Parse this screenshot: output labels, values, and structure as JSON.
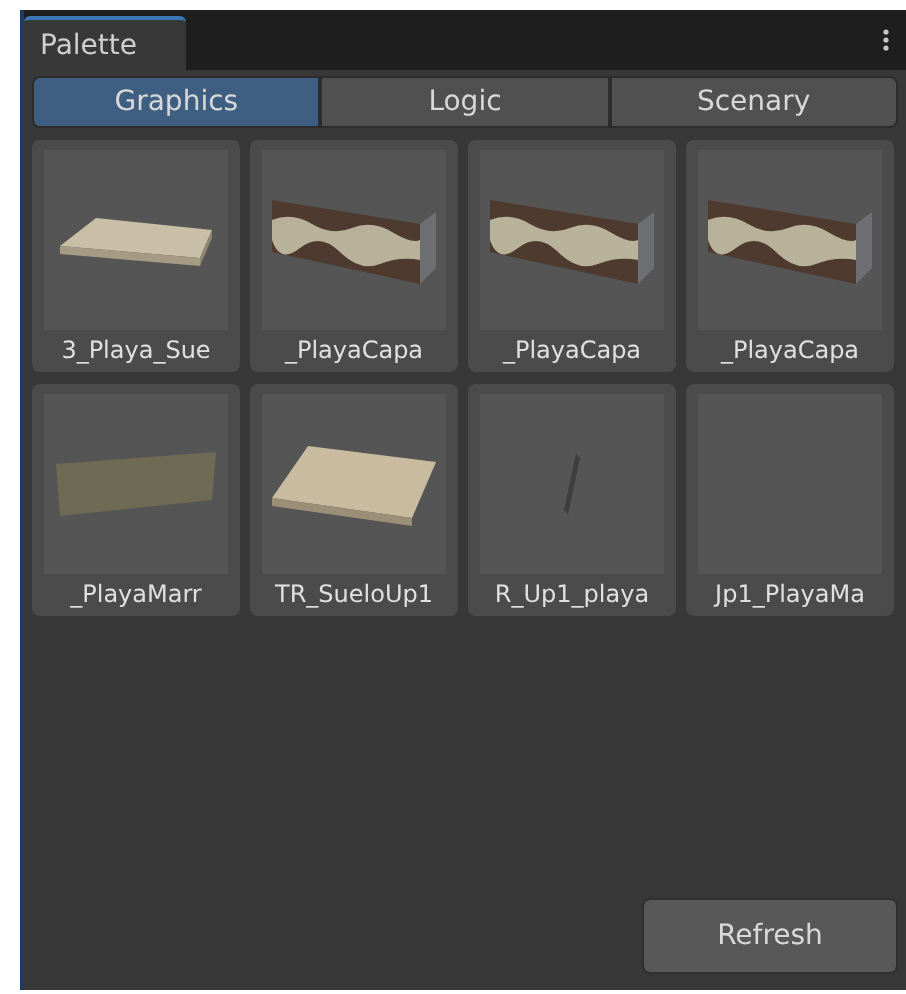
{
  "window": {
    "title": "Palette"
  },
  "tabs": [
    {
      "label": "Graphics",
      "selected": true
    },
    {
      "label": "Logic",
      "selected": false
    },
    {
      "label": "Scenary",
      "selected": false
    }
  ],
  "items": [
    {
      "label": "3_Playa_Sue",
      "kind": "slab"
    },
    {
      "label": "_PlayaCapa",
      "kind": "layers"
    },
    {
      "label": "_PlayaCapa",
      "kind": "layers"
    },
    {
      "label": "_PlayaCapa",
      "kind": "layers"
    },
    {
      "label": "_PlayaMarr",
      "kind": "panel"
    },
    {
      "label": "TR_SueloUp1",
      "kind": "plank"
    },
    {
      "label": "R_Up1_playa",
      "kind": "sliver"
    },
    {
      "label": "Jp1_PlayaMa",
      "kind": "empty"
    }
  ],
  "buttons": [
    {
      "label": "Refresh"
    }
  ]
}
